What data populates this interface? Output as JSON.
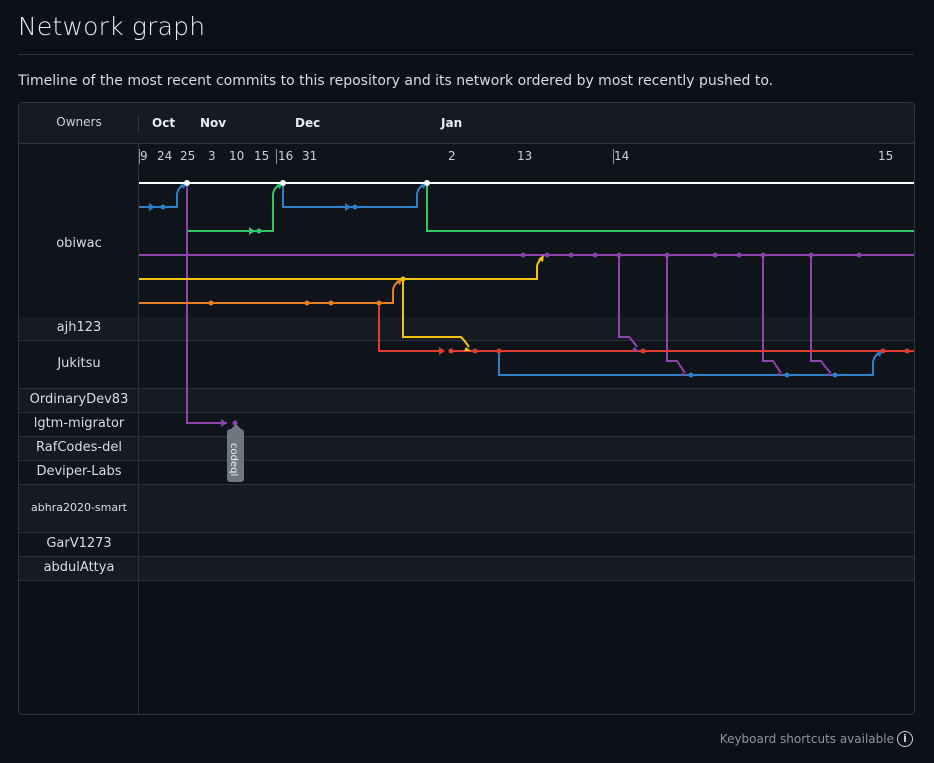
{
  "page": {
    "title": "Network graph",
    "description": "Timeline of the most recent commits to this repository and its network ordered by most recently pushed to.",
    "keyboard_hint": "Keyboard shortcuts available",
    "info_icon": "info-icon"
  },
  "graph": {
    "owners_header": "Owners",
    "months": [
      "Oct",
      "Nov",
      "Dec",
      "Jan"
    ],
    "days": [
      "9",
      "24",
      "25",
      "3",
      "10",
      "15",
      "16",
      "31",
      "2",
      "13",
      "14",
      "15"
    ],
    "owners": [
      "obiwac",
      "ajh123",
      "Jukitsu",
      "OrdinaryDev83",
      "lgtm-migrator",
      "RafCodes-del",
      "Deviper-Labs",
      "abhra2020-smart",
      "GarV1273",
      "abdulAttya"
    ],
    "branch_label": "codeql",
    "colors": {
      "white": "#ffffff",
      "blue": "#2f81c7",
      "green": "#2ec866",
      "purple": "#8e44ad",
      "yellow": "#f2c40f",
      "orange": "#e67e22",
      "red": "#e03c31"
    }
  }
}
